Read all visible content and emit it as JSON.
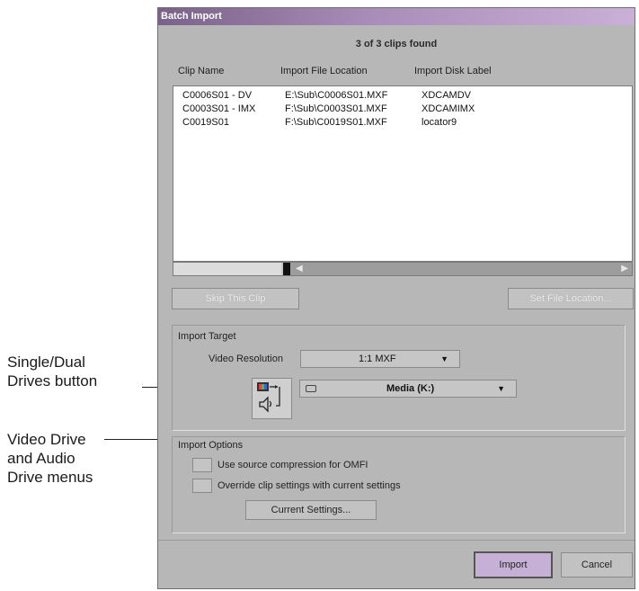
{
  "callouts": {
    "single_dual": [
      "Single/Dual",
      "Drives button"
    ],
    "video_audio": [
      "Video Drive",
      "and Audio",
      "Drive menus"
    ]
  },
  "dialog": {
    "title": "Batch Import",
    "found_text": "3 of 3 clips found",
    "columns": [
      "Clip Name",
      "Import File Location",
      "Import Disk Label"
    ],
    "rows": [
      {
        "name": "C0006S01 - DV",
        "location": "E:\\Sub\\C0006S01.MXF",
        "label": "XDCAMDV"
      },
      {
        "name": "C0003S01 - IMX",
        "location": "F:\\Sub\\C0003S01.MXF",
        "label": "XDCAMIMX"
      },
      {
        "name": "C0019S01",
        "location": "F:\\Sub\\C0019S01.MXF",
        "label": "locator9"
      }
    ],
    "skip_button": "Skip This Clip",
    "set_location_button": "Set File Location...",
    "import_target": {
      "heading": "Import Target",
      "video_res_label": "Video Resolution",
      "video_res_value": "1:1  MXF",
      "drive_value": "Media (K:)"
    },
    "import_options": {
      "heading": "Import Options",
      "option1": "Use source compression for OMFI",
      "option2": "Override clip settings with current settings",
      "current_settings_button": "Current Settings..."
    },
    "import_button": "Import",
    "cancel_button": "Cancel"
  }
}
